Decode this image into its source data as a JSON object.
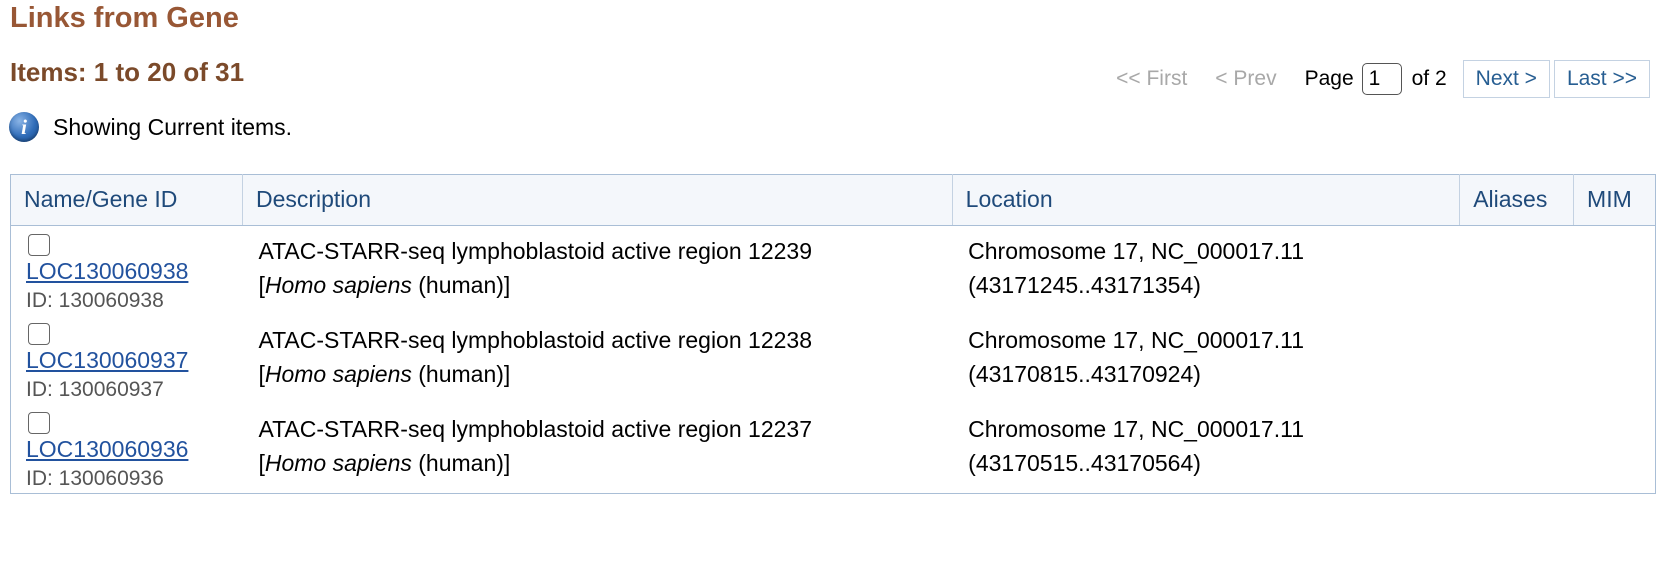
{
  "page_title": "Links from Gene",
  "items_count": "Items: 1 to 20 of 31",
  "pager": {
    "first": "<< First",
    "prev": "< Prev",
    "page_label": "Page",
    "current_page": "1",
    "of_label": "of 2",
    "next": "Next >",
    "last": "Last >>"
  },
  "info": {
    "icon": "info-icon",
    "text": "Showing Current items."
  },
  "table": {
    "headers": [
      "Name/Gene ID",
      "Description",
      "Location",
      "Aliases",
      "MIM"
    ],
    "rows": [
      {
        "name": "LOC130060938",
        "id": "ID: 130060938",
        "desc_main": "ATAC-STARR-seq lymphoblastoid active region 12239",
        "desc_open": "[",
        "desc_species": "Homo sapiens",
        "desc_close": " (human)]",
        "location_line1": "Chromosome 17, NC_000017.11",
        "location_line2": "(43171245..43171354)",
        "aliases": "",
        "mim": ""
      },
      {
        "name": "LOC130060937",
        "id": "ID: 130060937",
        "desc_main": "ATAC-STARR-seq lymphoblastoid active region 12238",
        "desc_open": "[",
        "desc_species": "Homo sapiens",
        "desc_close": " (human)]",
        "location_line1": "Chromosome 17, NC_000017.11",
        "location_line2": "(43170815..43170924)",
        "aliases": "",
        "mim": ""
      },
      {
        "name": "LOC130060936",
        "id": "ID: 130060936",
        "desc_main": "ATAC-STARR-seq lymphoblastoid active region 12237",
        "desc_open": "[",
        "desc_species": "Homo sapiens",
        "desc_close": " (human)]",
        "location_line1": "Chromosome 17, NC_000017.11",
        "location_line2": "(43170515..43170564)",
        "aliases": "",
        "mim": ""
      }
    ]
  }
}
